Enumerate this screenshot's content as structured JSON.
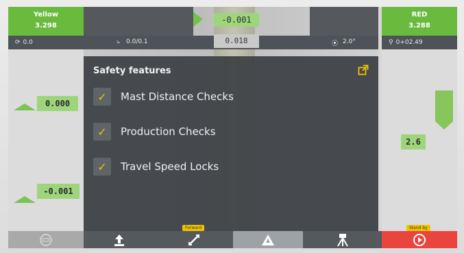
{
  "top": {
    "left_status": {
      "name": "Yellow",
      "value": "3.298",
      "sub": "0.0",
      "sub_icon": "rotation-icon"
    },
    "right_status": {
      "name": "RED",
      "value": "3.288",
      "sub": "0+02.49",
      "sub_icon": "station-icon"
    },
    "slope": {
      "value": "0.0/0.1",
      "icon": "slope-icon"
    },
    "offset_top": "-0.001",
    "offset_mid": "0.018",
    "angle": {
      "value": "2.0°",
      "icon": "angle-icon"
    }
  },
  "left_side": {
    "upper_value": "0.000",
    "lower_value": "-0.001"
  },
  "right_side": {
    "value": "2.6"
  },
  "dialog": {
    "title": "Safety features",
    "options": [
      {
        "label": "Mast Distance Checks",
        "checked": true
      },
      {
        "label": "Production Checks",
        "checked": true
      },
      {
        "label": "Travel Speed Locks",
        "checked": true
      }
    ]
  },
  "toolbar": {
    "items": [
      {
        "icon": "menu-icon"
      },
      {
        "icon": "upload-icon"
      },
      {
        "icon": "forward-icon",
        "badge": "Forward"
      },
      {
        "icon": "navigation-icon"
      },
      {
        "icon": "tripod-icon"
      },
      {
        "icon": "play-icon",
        "badge": "Stand by"
      }
    ]
  },
  "colors": {
    "accent_green": "#6aba3e",
    "alert_red": "#e9443e",
    "check_yellow": "#f2c200"
  }
}
